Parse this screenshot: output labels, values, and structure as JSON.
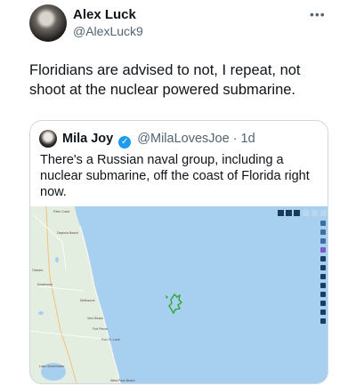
{
  "tweet": {
    "author_name": "Alex Luck",
    "author_handle": "@AlexLuck9",
    "more_icon": "•••",
    "text": "Floridians are advised to not, I repeat, not shoot at the nuclear powered submarine."
  },
  "quote": {
    "author_name": "Mila Joy",
    "verified_icon": "✓",
    "author_handle": "@MilaLovesJoe",
    "time": "· 1d",
    "text": "There's a Russian naval group, including a nuclear submarine, off the coast of Florida right now."
  },
  "map": {
    "labels": [
      "Palm Coast",
      "Daytona Beach",
      "Orlando",
      "Melbourne",
      "Port St. Lucie",
      "West Palm Beach",
      "Lake Okeechobee",
      "Fort Pierce",
      "Vero Beach",
      "Kissimmee"
    ],
    "colors": {
      "ocean": "#a7cff0",
      "land": "#e4eee0",
      "ship": "#2aa62a"
    }
  }
}
